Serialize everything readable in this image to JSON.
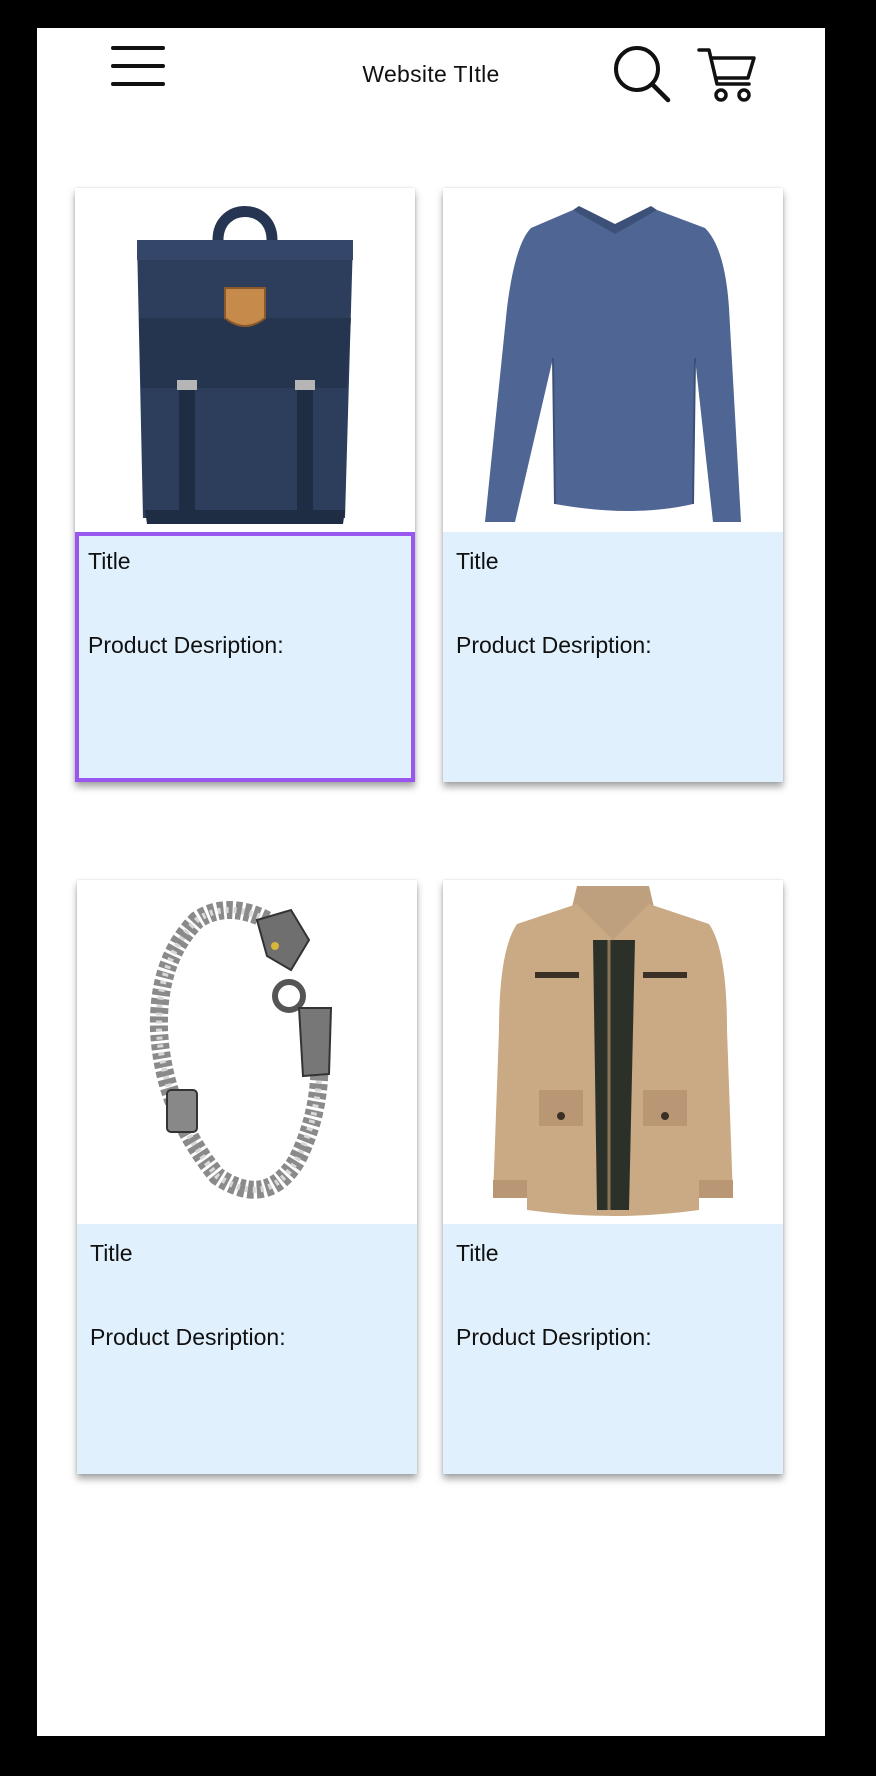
{
  "header": {
    "title": "Website TItle",
    "menu_icon": "hamburger-menu-icon",
    "search_icon": "search-icon",
    "cart_icon": "shopping-cart-icon"
  },
  "products": [
    {
      "image": "navy-backpack",
      "title": "Title",
      "description": "Product Desription:",
      "selected": true
    },
    {
      "image": "blue-long-sleeve-shirt",
      "title": "Title",
      "description": "Product Desription:",
      "selected": false
    },
    {
      "image": "silver-dragon-bracelet",
      "title": "Title",
      "description": "Product Desription:",
      "selected": false
    },
    {
      "image": "khaki-jacket",
      "title": "Title",
      "description": "Product Desription:",
      "selected": false
    }
  ],
  "colors": {
    "card_info_bg": "#e0f0fc",
    "selection_outline": "#9a57f0"
  }
}
